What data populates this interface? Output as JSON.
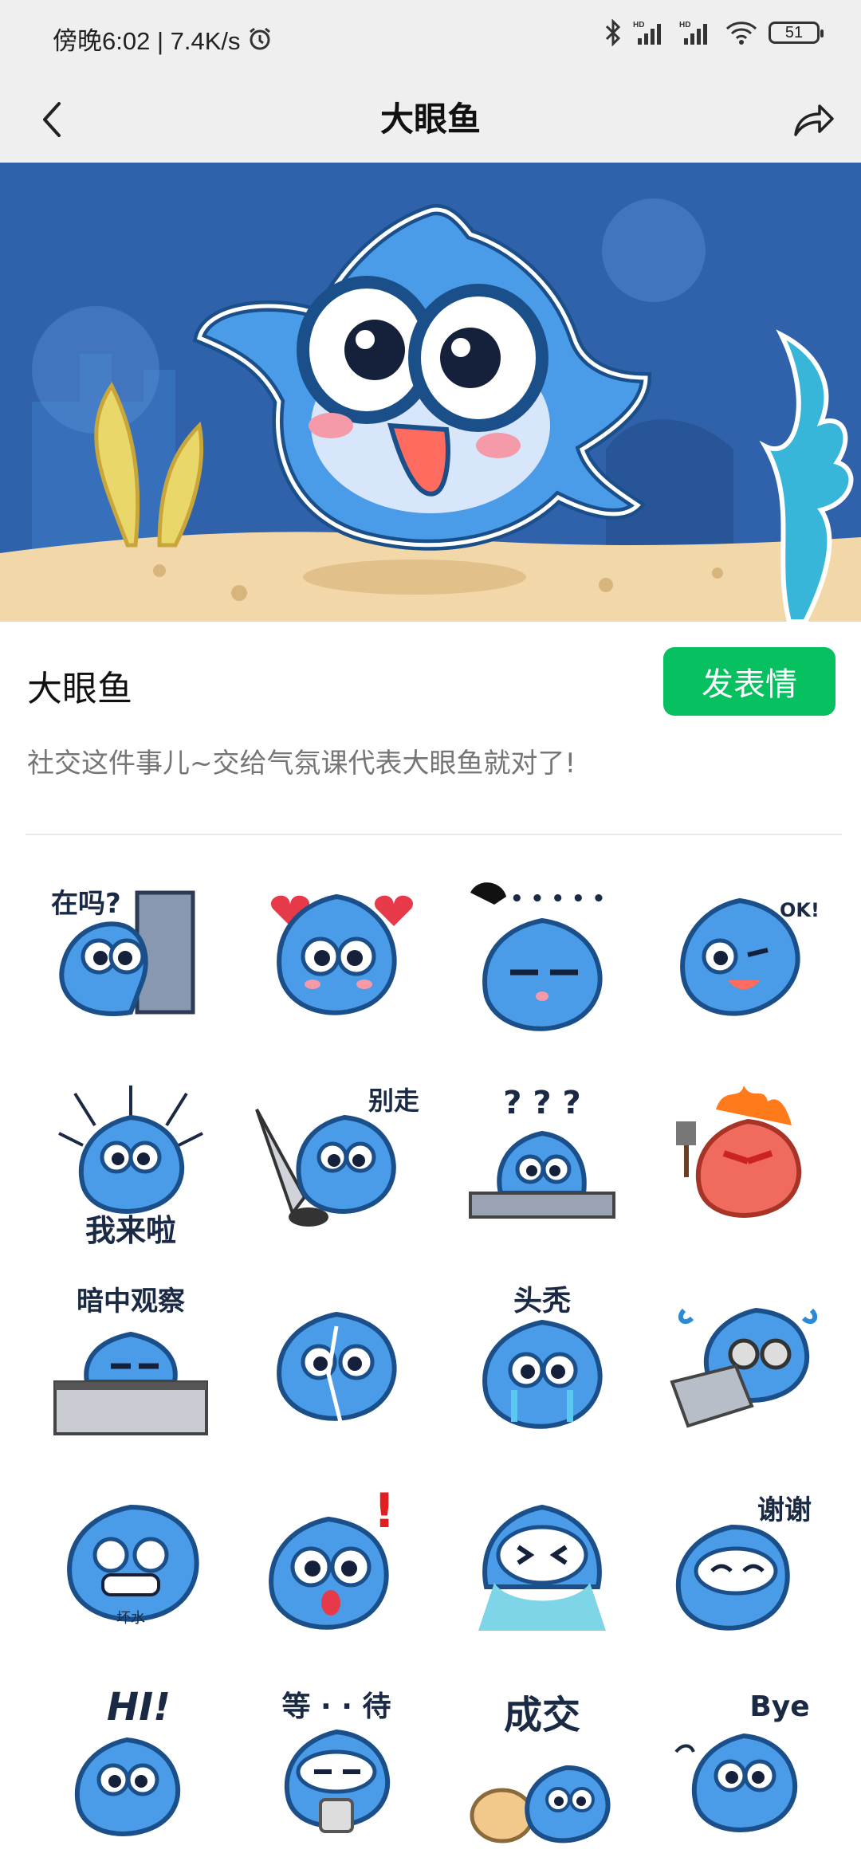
{
  "status_bar": {
    "time_text": "傍晚6:02 | 7.4K/s",
    "battery_level": "51",
    "icons": [
      "alarm-icon",
      "bluetooth-icon",
      "hd-signal-icon",
      "hd-signal-icon",
      "wifi-icon",
      "battery-icon"
    ]
  },
  "nav": {
    "title": "大眼鱼",
    "back_icon": "back-chevron-icon",
    "share_icon": "share-arrow-icon"
  },
  "pack": {
    "name": "大眼鱼",
    "send_label": "发表情",
    "description": "社交这件事儿~交给气氛课代表大眼鱼就对了!"
  },
  "stickers": [
    {
      "caption": "在吗?"
    },
    {
      "caption": ""
    },
    {
      "caption": "• • • • •"
    },
    {
      "caption": "OK!"
    },
    {
      "caption": "我来啦"
    },
    {
      "caption": "别走"
    },
    {
      "caption": "? ? ?"
    },
    {
      "caption": ""
    },
    {
      "caption": "暗中观察"
    },
    {
      "caption": ""
    },
    {
      "caption": "头秃"
    },
    {
      "caption": ""
    },
    {
      "caption": "坏水"
    },
    {
      "caption": "!"
    },
    {
      "caption": ""
    },
    {
      "caption": "谢谢"
    },
    {
      "caption": "HI!"
    },
    {
      "caption": "等 · · 待"
    },
    {
      "caption": "成交"
    },
    {
      "caption": "Bye"
    }
  ],
  "colors": {
    "accent_green": "#07c160",
    "fish_blue": "#4a9be8",
    "banner_blue": "#2c5aa0",
    "sand": "#f2d8a8"
  }
}
